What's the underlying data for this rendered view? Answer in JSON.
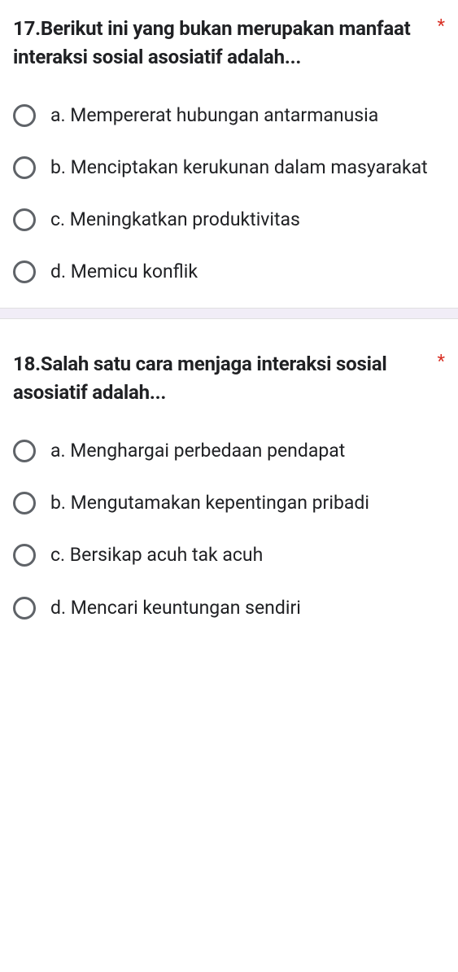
{
  "questions": [
    {
      "title": "17.Berikut ini yang bukan merupakan manfaat interaksi sosial asosiatif adalah...",
      "required": "*",
      "options": [
        "a. Mempererat hubungan antarmanusia",
        "b. Menciptakan kerukunan dalam masyarakat",
        "c. Meningkatkan produktivitas",
        "d. Memicu konflik"
      ]
    },
    {
      "title": "18.Salah satu cara menjaga interaksi sosial asosiatif adalah...",
      "required": "*",
      "options": [
        "a. Menghargai perbedaan pendapat",
        "b. Mengutamakan kepentingan pribadi",
        "c. Bersikap acuh tak acuh",
        "d. Mencari keuntungan sendiri"
      ]
    }
  ]
}
